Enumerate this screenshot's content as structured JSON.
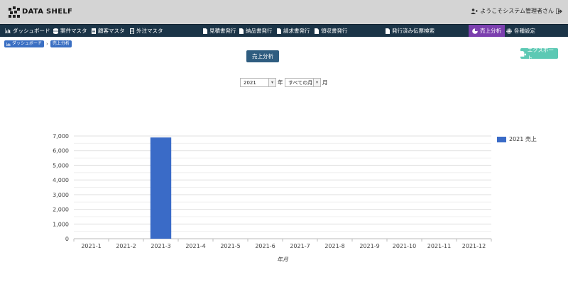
{
  "header": {
    "brand": "DATA SHELF",
    "welcome": "ようこそシステム管理者さん"
  },
  "nav": {
    "dashboard": "ダッシュボード",
    "projects": "案件マスタ",
    "customers": "顧客マスタ",
    "outsourcing": "外注マスタ",
    "estimate": "見積書発行",
    "delivery": "納品書発行",
    "invoice": "請求書発行",
    "receipt": "領収書発行",
    "search": "発行済み伝票検索",
    "sales": "売上分析",
    "settings": "各種設定"
  },
  "breadcrumb": {
    "home": "ダッシュボード",
    "current": "売上分析"
  },
  "page": {
    "title": "売上分析",
    "export_label": "エクスポート"
  },
  "filters": {
    "year": "2021",
    "year_unit": "年",
    "month": "すべての月",
    "month_unit": "月"
  },
  "chart_data": {
    "type": "bar",
    "categories": [
      "2021-1",
      "2021-2",
      "2021-3",
      "2021-4",
      "2021-5",
      "2021-6",
      "2021-7",
      "2021-8",
      "2021-9",
      "2021-10",
      "2021-11",
      "2021-12"
    ],
    "series": [
      {
        "name": "2021 売上",
        "values": [
          0,
          0,
          6900,
          0,
          0,
          0,
          0,
          0,
          0,
          0,
          0,
          0
        ]
      }
    ],
    "xlabel": "年月",
    "ylabel": "",
    "ylim": [
      0,
      7000
    ],
    "yticks": [
      0,
      1000,
      2000,
      3000,
      4000,
      5000,
      6000,
      7000
    ],
    "ytick_labels": [
      "0",
      "1,000",
      "2,000",
      "3,000",
      "4,000",
      "5,000",
      "6,000",
      "7,000"
    ],
    "grid": true,
    "legend": "top-right",
    "color": "#3a6bc7"
  }
}
